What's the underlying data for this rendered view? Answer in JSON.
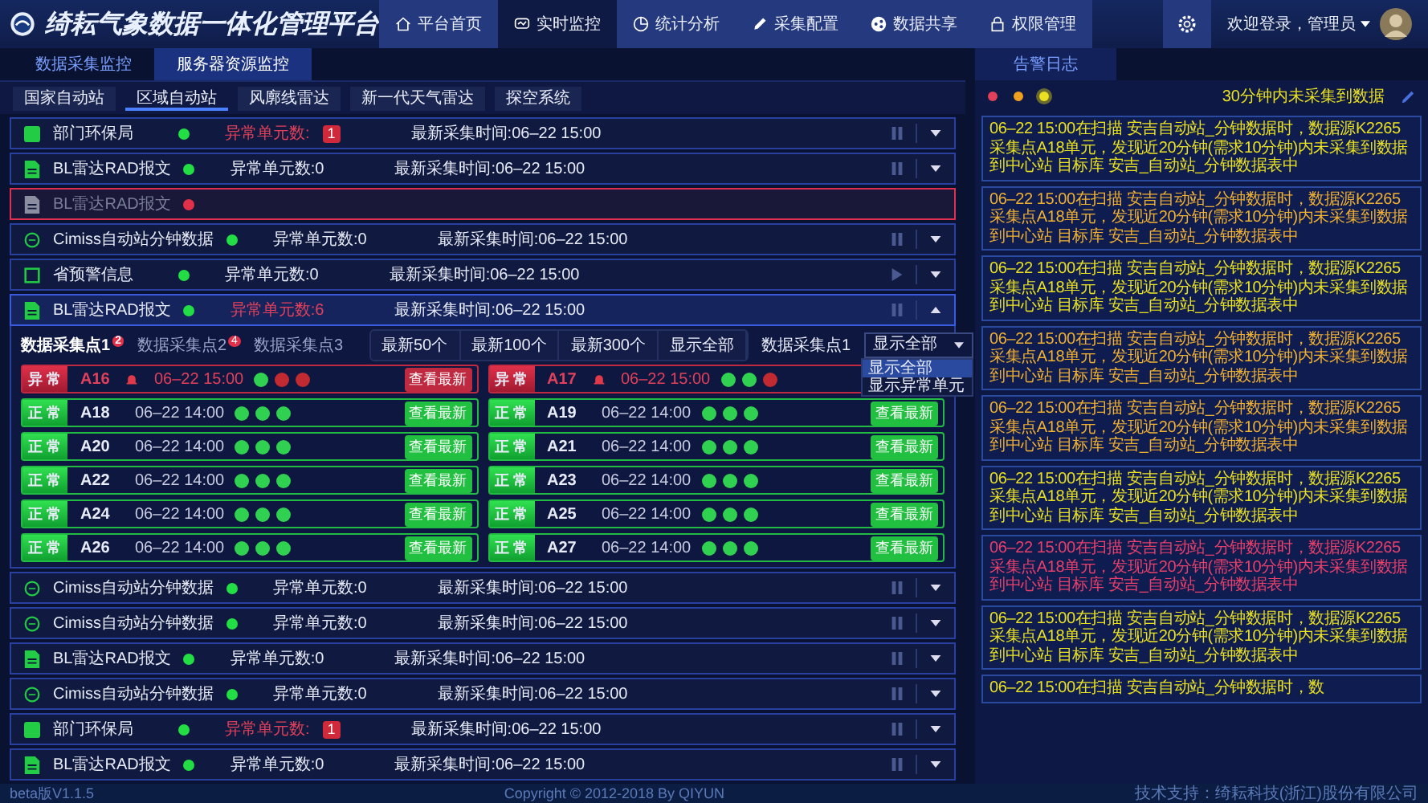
{
  "header": {
    "title": "绮耘气象数据一体化管理平台",
    "nav": [
      {
        "label": "平台首页",
        "selected": false
      },
      {
        "label": "实时监控",
        "selected": true
      },
      {
        "label": "统计分析",
        "selected": false
      },
      {
        "label": "采集配置",
        "selected": false
      },
      {
        "label": "数据共享",
        "selected": false
      },
      {
        "label": "权限管理",
        "selected": false
      }
    ],
    "user": "欢迎登录，管理员"
  },
  "tabs": [
    {
      "label": "数据采集监控",
      "selected": false
    },
    {
      "label": "服务器资源监控",
      "selected": true
    }
  ],
  "filters": [
    {
      "label": "国家自动站",
      "selected": false
    },
    {
      "label": "区域自动站",
      "selected": true
    },
    {
      "label": "风廓线雷达",
      "selected": false
    },
    {
      "label": "新一代天气雷达",
      "selected": false
    },
    {
      "label": "探空系统",
      "selected": false
    }
  ],
  "rows": [
    {
      "kind": "box",
      "name": "部门环保局",
      "color": "#22dd44",
      "abnormal_label": "异常单元数:",
      "abnormal": true,
      "badge": "1",
      "time": "最新采集时间:06–22 15:00",
      "running": true,
      "error": false,
      "expanded": false
    },
    {
      "kind": "doc",
      "name": "BL雷达RAD报文",
      "color": "#22dd44",
      "abnormal_label": "异常单元数:0",
      "abnormal": false,
      "time": "最新采集时间:06–22 15:00",
      "running": true,
      "error": false,
      "expanded": false
    },
    {
      "kind": "doc",
      "name": "BL雷达RAD报文",
      "color": "#e0304a",
      "error": true
    },
    {
      "kind": "ring",
      "name": "Cimiss自动站分钟数据",
      "color": "#22dd44",
      "abnormal_label": "异常单元数:0",
      "abnormal": false,
      "time": "最新采集时间:06–22 15:00",
      "running": true,
      "error": false,
      "expanded": false
    },
    {
      "kind": "square",
      "name": "省预警信息",
      "color": "#22dd44",
      "abnormal_label": "异常单元数:0",
      "abnormal": false,
      "time": "最新采集时间:06–22 15:00",
      "running": false,
      "error": false,
      "expanded": false
    },
    {
      "kind": "doc",
      "name": "BL雷达RAD报文",
      "color": "#22dd44",
      "abnormal_label": "异常单元数:6",
      "abnormal": true,
      "time": "最新采集时间:06–22 15:00",
      "running": true,
      "error": false,
      "expanded": true,
      "detail": {
        "points": [
          {
            "label": "数据采集点1",
            "badge": "2",
            "selected": true
          },
          {
            "label": "数据采集点2",
            "badge": "4",
            "selected": false
          },
          {
            "label": "数据采集点3",
            "selected": false
          }
        ],
        "ranges": [
          "最新50个",
          "最新100个",
          "最新300个",
          "显示全部"
        ],
        "point_label": "数据采集点1",
        "select": {
          "value": "显示全部",
          "options": [
            {
              "label": "显示全部",
              "selected": true
            },
            {
              "label": "显示异常单元",
              "selected": false
            }
          ]
        },
        "units": [
          {
            "status": "异 常",
            "alert": true,
            "id": "A16",
            "time": "06–22 15:00",
            "lights": [
              true,
              false,
              false
            ],
            "button": "查看最新"
          },
          {
            "status": "异 常",
            "alert": true,
            "id": "A17",
            "time": "06–22 15:00",
            "lights": [
              true,
              true,
              false
            ]
          },
          {
            "status": "正 常",
            "alert": false,
            "id": "A18",
            "time": "06–22 14:00",
            "lights": [
              true,
              true,
              true
            ],
            "button": "查看最新"
          },
          {
            "status": "正 常",
            "alert": false,
            "id": "A19",
            "time": "06–22 14:00",
            "lights": [
              true,
              true,
              true
            ],
            "button": "查看最新"
          },
          {
            "status": "正 常",
            "alert": false,
            "id": "A20",
            "time": "06–22 14:00",
            "lights": [
              true,
              true,
              true
            ],
            "button": "查看最新"
          },
          {
            "status": "正 常",
            "alert": false,
            "id": "A21",
            "time": "06–22 14:00",
            "lights": [
              true,
              true,
              true
            ],
            "button": "查看最新"
          },
          {
            "status": "正 常",
            "alert": false,
            "id": "A22",
            "time": "06–22 14:00",
            "lights": [
              true,
              true,
              true
            ],
            "button": "查看最新"
          },
          {
            "status": "正 常",
            "alert": false,
            "id": "A23",
            "time": "06–22 14:00",
            "lights": [
              true,
              true,
              true
            ],
            "button": "查看最新"
          },
          {
            "status": "正 常",
            "alert": false,
            "id": "A24",
            "time": "06–22 14:00",
            "lights": [
              true,
              true,
              true
            ],
            "button": "查看最新"
          },
          {
            "status": "正 常",
            "alert": false,
            "id": "A25",
            "time": "06–22 14:00",
            "lights": [
              true,
              true,
              true
            ],
            "button": "查看最新"
          },
          {
            "status": "正 常",
            "alert": false,
            "id": "A26",
            "time": "06–22 14:00",
            "lights": [
              true,
              true,
              true
            ],
            "button": "查看最新"
          },
          {
            "status": "正 常",
            "alert": false,
            "id": "A27",
            "time": "06–22 14:00",
            "lights": [
              true,
              true,
              true
            ],
            "button": "查看最新"
          }
        ]
      }
    },
    {
      "kind": "ring",
      "name": "Cimiss自动站分钟数据",
      "color": "#22dd44",
      "abnormal_label": "异常单元数:0",
      "abnormal": false,
      "time": "最新采集时间:06–22 15:00",
      "running": true,
      "error": false,
      "expanded": false
    },
    {
      "kind": "ring",
      "name": "Cimiss自动站分钟数据",
      "color": "#22dd44",
      "abnormal_label": "异常单元数:0",
      "abnormal": false,
      "time": "最新采集时间:06–22 15:00",
      "running": true,
      "error": false,
      "expanded": false
    },
    {
      "kind": "doc",
      "name": "BL雷达RAD报文",
      "color": "#22dd44",
      "abnormal_label": "异常单元数:0",
      "abnormal": false,
      "time": "最新采集时间:06–22 15:00",
      "running": true,
      "error": false,
      "expanded": false
    },
    {
      "kind": "ring",
      "name": "Cimiss自动站分钟数据",
      "color": "#22dd44",
      "abnormal_label": "异常单元数:0",
      "abnormal": false,
      "time": "最新采集时间:06–22 15:00",
      "running": true,
      "error": false,
      "expanded": false
    },
    {
      "kind": "box",
      "name": "部门环保局",
      "color": "#22dd44",
      "abnormal_label": "异常单元数:",
      "abnormal": true,
      "badge": "1",
      "time": "最新采集时间:06–22 15:00",
      "running": true,
      "error": false,
      "expanded": false
    },
    {
      "kind": "doc",
      "name": "BL雷达RAD报文",
      "color": "#22dd44",
      "abnormal_label": "异常单元数:0",
      "abnormal": false,
      "time": "最新采集时间:06–22 15:00",
      "running": true,
      "error": false,
      "expanded": false
    }
  ],
  "log": {
    "title": "告警日志",
    "levels": [
      {
        "color": "#e0405a",
        "selected": false
      },
      {
        "color": "#f0a020",
        "selected": false
      },
      {
        "color": "#e8e020",
        "selected": true
      }
    ],
    "caption": "30分钟内未采集到数据",
    "entries": [
      {
        "text": "06–22 15:00在扫描 安吉自动站_分钟数据时，数据源K2265采集点A18单元，发现近20分钟(需求10分钟)内未采集到数据到中心站 目标库 安吉_自动站_分钟数据表中",
        "color": "#e8e020"
      },
      {
        "text": "06–22 15:00在扫描 安吉自动站_分钟数据时，数据源K2265采集点A18单元，发现近20分钟(需求10分钟)内未采集到数据到中心站 目标库 安吉_自动站_分钟数据表中",
        "color": "#f0b030"
      },
      {
        "text": "06–22 15:00在扫描 安吉自动站_分钟数据时，数据源K2265采集点A18单元，发现近20分钟(需求10分钟)内未采集到数据到中心站 目标库 安吉_自动站_分钟数据表中",
        "color": "#e8e020"
      },
      {
        "text": "06–22 15:00在扫描 安吉自动站_分钟数据时，数据源K2265采集点A18单元，发现近20分钟(需求10分钟)内未采集到数据到中心站 目标库 安吉_自动站_分钟数据表中",
        "color": "#f0b030"
      },
      {
        "text": "06–22 15:00在扫描 安吉自动站_分钟数据时，数据源K2265采集点A18单元，发现近20分钟(需求10分钟)内未采集到数据到中心站 目标库 安吉_自动站_分钟数据表中",
        "color": "#f0b030"
      },
      {
        "text": "06–22 15:00在扫描 安吉自动站_分钟数据时，数据源K2265采集点A18单元，发现近20分钟(需求10分钟)内未采集到数据到中心站 目标库 安吉_自动站_分钟数据表中",
        "color": "#e8e020"
      },
      {
        "text": "06–22 15:00在扫描 安吉自动站_分钟数据时，数据源K2265采集点A18单元，发现近20分钟(需求10分钟)内未采集到数据到中心站 目标库 安吉_自动站_分钟数据表中",
        "color": "#e8406a"
      },
      {
        "text": "06–22 15:00在扫描 安吉自动站_分钟数据时，数据源K2265采集点A18单元，发现近20分钟(需求10分钟)内未采集到数据到中心站 目标库 安吉_自动站_分钟数据表中",
        "color": "#e8e020"
      },
      {
        "text": "06–22 15:00在扫描 安吉自动站_分钟数据时，数",
        "color": "#e8e020"
      }
    ]
  },
  "footer": {
    "version": "beta版V1.1.5",
    "copyright": "Copyright © 2012-2018 By QIYUN",
    "support": "技术支持：绮耘科技(浙江)股份有限公司"
  }
}
